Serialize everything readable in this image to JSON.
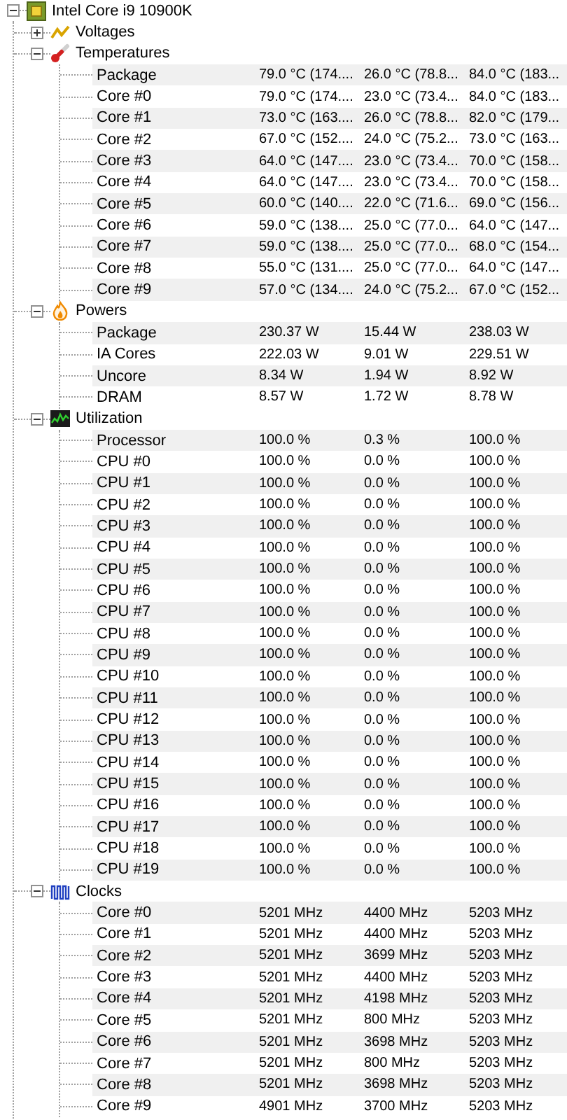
{
  "device": {
    "name": "Intel Core i9 10900K",
    "expanded": true
  },
  "groups": [
    {
      "kind": "voltages",
      "label": "Voltages",
      "expanded": false
    },
    {
      "kind": "temperatures",
      "label": "Temperatures",
      "expanded": true,
      "rows": [
        {
          "label": "Package",
          "value": "79.0 °C (174....",
          "min": "26.0 °C (78.8...",
          "max": "84.0 °C (183..."
        },
        {
          "label": "Core #0",
          "value": "79.0 °C (174....",
          "min": "23.0 °C (73.4...",
          "max": "84.0 °C (183..."
        },
        {
          "label": "Core #1",
          "value": "73.0 °C (163....",
          "min": "26.0 °C (78.8...",
          "max": "82.0 °C (179..."
        },
        {
          "label": "Core #2",
          "value": "67.0 °C (152....",
          "min": "24.0 °C (75.2...",
          "max": "73.0 °C (163..."
        },
        {
          "label": "Core #3",
          "value": "64.0 °C (147....",
          "min": "23.0 °C (73.4...",
          "max": "70.0 °C (158..."
        },
        {
          "label": "Core #4",
          "value": "64.0 °C (147....",
          "min": "23.0 °C (73.4...",
          "max": "70.0 °C (158..."
        },
        {
          "label": "Core #5",
          "value": "60.0 °C (140....",
          "min": "22.0 °C (71.6...",
          "max": "69.0 °C (156..."
        },
        {
          "label": "Core #6",
          "value": "59.0 °C (138....",
          "min": "25.0 °C (77.0...",
          "max": "64.0 °C (147..."
        },
        {
          "label": "Core #7",
          "value": "59.0 °C (138....",
          "min": "25.0 °C (77.0...",
          "max": "68.0 °C (154..."
        },
        {
          "label": "Core #8",
          "value": "55.0 °C (131....",
          "min": "25.0 °C (77.0...",
          "max": "64.0 °C (147..."
        },
        {
          "label": "Core #9",
          "value": "57.0 °C (134....",
          "min": "24.0 °C (75.2...",
          "max": "67.0 °C (152..."
        }
      ]
    },
    {
      "kind": "powers",
      "label": "Powers",
      "expanded": true,
      "rows": [
        {
          "label": "Package",
          "value": "230.37 W",
          "min": "15.44 W",
          "max": "238.03 W"
        },
        {
          "label": "IA Cores",
          "value": "222.03 W",
          "min": "9.01 W",
          "max": "229.51 W"
        },
        {
          "label": "Uncore",
          "value": "8.34 W",
          "min": "1.94 W",
          "max": "8.92 W"
        },
        {
          "label": "DRAM",
          "value": "8.57 W",
          "min": "1.72 W",
          "max": "8.78 W"
        }
      ]
    },
    {
      "kind": "utilization",
      "label": "Utilization",
      "expanded": true,
      "rows": [
        {
          "label": "Processor",
          "value": "100.0 %",
          "min": "0.3 %",
          "max": "100.0 %"
        },
        {
          "label": "CPU #0",
          "value": "100.0 %",
          "min": "0.0 %",
          "max": "100.0 %"
        },
        {
          "label": "CPU #1",
          "value": "100.0 %",
          "min": "0.0 %",
          "max": "100.0 %"
        },
        {
          "label": "CPU #2",
          "value": "100.0 %",
          "min": "0.0 %",
          "max": "100.0 %"
        },
        {
          "label": "CPU #3",
          "value": "100.0 %",
          "min": "0.0 %",
          "max": "100.0 %"
        },
        {
          "label": "CPU #4",
          "value": "100.0 %",
          "min": "0.0 %",
          "max": "100.0 %"
        },
        {
          "label": "CPU #5",
          "value": "100.0 %",
          "min": "0.0 %",
          "max": "100.0 %"
        },
        {
          "label": "CPU #6",
          "value": "100.0 %",
          "min": "0.0 %",
          "max": "100.0 %"
        },
        {
          "label": "CPU #7",
          "value": "100.0 %",
          "min": "0.0 %",
          "max": "100.0 %"
        },
        {
          "label": "CPU #8",
          "value": "100.0 %",
          "min": "0.0 %",
          "max": "100.0 %"
        },
        {
          "label": "CPU #9",
          "value": "100.0 %",
          "min": "0.0 %",
          "max": "100.0 %"
        },
        {
          "label": "CPU #10",
          "value": "100.0 %",
          "min": "0.0 %",
          "max": "100.0 %"
        },
        {
          "label": "CPU #11",
          "value": "100.0 %",
          "min": "0.0 %",
          "max": "100.0 %"
        },
        {
          "label": "CPU #12",
          "value": "100.0 %",
          "min": "0.0 %",
          "max": "100.0 %"
        },
        {
          "label": "CPU #13",
          "value": "100.0 %",
          "min": "0.0 %",
          "max": "100.0 %"
        },
        {
          "label": "CPU #14",
          "value": "100.0 %",
          "min": "0.0 %",
          "max": "100.0 %"
        },
        {
          "label": "CPU #15",
          "value": "100.0 %",
          "min": "0.0 %",
          "max": "100.0 %"
        },
        {
          "label": "CPU #16",
          "value": "100.0 %",
          "min": "0.0 %",
          "max": "100.0 %"
        },
        {
          "label": "CPU #17",
          "value": "100.0 %",
          "min": "0.0 %",
          "max": "100.0 %"
        },
        {
          "label": "CPU #18",
          "value": "100.0 %",
          "min": "0.0 %",
          "max": "100.0 %"
        },
        {
          "label": "CPU #19",
          "value": "100.0 %",
          "min": "0.0 %",
          "max": "100.0 %"
        }
      ]
    },
    {
      "kind": "clocks",
      "label": "Clocks",
      "expanded": true,
      "rows": [
        {
          "label": "Core #0",
          "value": "5201 MHz",
          "min": "4400 MHz",
          "max": "5203 MHz"
        },
        {
          "label": "Core #1",
          "value": "5201 MHz",
          "min": "4400 MHz",
          "max": "5203 MHz"
        },
        {
          "label": "Core #2",
          "value": "5201 MHz",
          "min": "3699 MHz",
          "max": "5203 MHz"
        },
        {
          "label": "Core #3",
          "value": "5201 MHz",
          "min": "4400 MHz",
          "max": "5203 MHz"
        },
        {
          "label": "Core #4",
          "value": "5201 MHz",
          "min": "4198 MHz",
          "max": "5203 MHz"
        },
        {
          "label": "Core #5",
          "value": "5201 MHz",
          "min": "800 MHz",
          "max": "5203 MHz"
        },
        {
          "label": "Core #6",
          "value": "5201 MHz",
          "min": "3698 MHz",
          "max": "5203 MHz"
        },
        {
          "label": "Core #7",
          "value": "5201 MHz",
          "min": "800 MHz",
          "max": "5203 MHz"
        },
        {
          "label": "Core #8",
          "value": "5201 MHz",
          "min": "3698 MHz",
          "max": "5203 MHz"
        },
        {
          "label": "Core #9",
          "value": "4901 MHz",
          "min": "3700 MHz",
          "max": "5203 MHz"
        }
      ]
    }
  ]
}
